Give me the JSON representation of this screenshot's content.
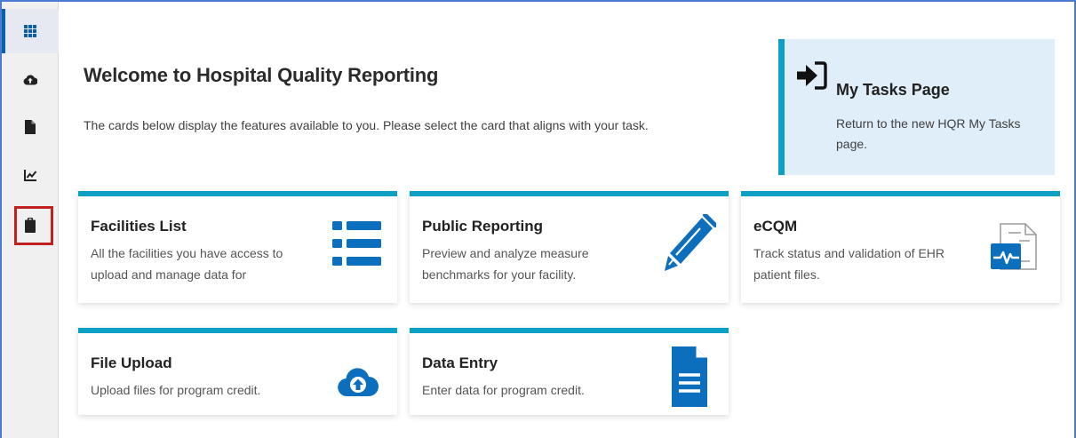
{
  "sidebar": {
    "items": [
      {
        "icon": "grid-icon",
        "active": true
      },
      {
        "icon": "cloud-upload-icon",
        "active": false
      },
      {
        "icon": "file-icon",
        "active": false
      },
      {
        "icon": "line-chart-icon",
        "active": false
      },
      {
        "icon": "clipboard-icon",
        "active": false,
        "highlighted": true
      }
    ]
  },
  "main": {
    "title": "Welcome to Hospital Quality Reporting",
    "subtitle": "The cards below display the features available to you. Please select the card that aligns with your task."
  },
  "tasks_card": {
    "title": "My Tasks Page",
    "description": "Return to the new HQR My Tasks page.",
    "icon": "sign-in-icon"
  },
  "cards": [
    {
      "title": "Facilities List",
      "description": "All the facilities you have access to upload and manage data for",
      "icon": "list-icon"
    },
    {
      "title": "Public Reporting",
      "description": "Preview and analyze measure benchmarks for your facility.",
      "icon": "pencil-icon"
    },
    {
      "title": "eCQM",
      "description": "Track status and validation of EHR patient files.",
      "icon": "health-file-icon"
    },
    {
      "title": "File Upload",
      "description": "Upload files for program credit.",
      "icon": "cloud-upload-icon"
    },
    {
      "title": "Data Entry",
      "description": "Enter data for program credit.",
      "icon": "document-icon"
    }
  ],
  "colors": {
    "accent": "#0e9fc5",
    "icon_blue": "#0b6fbd",
    "highlight_red": "#c0201f",
    "tasks_bg": "#dfeef8"
  }
}
